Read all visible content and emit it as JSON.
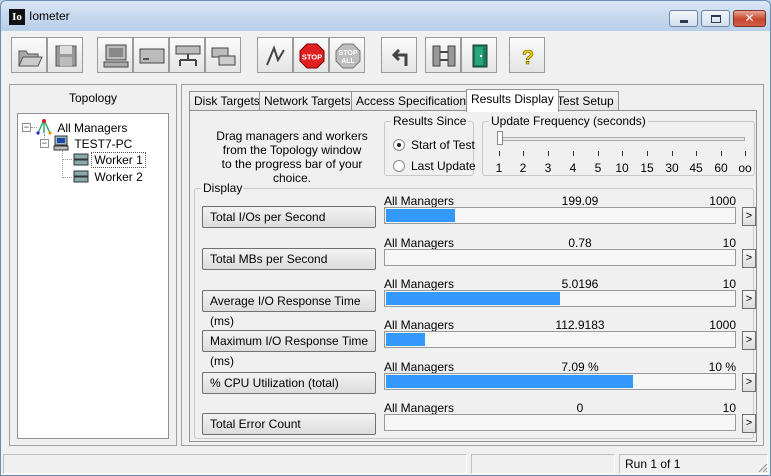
{
  "window": {
    "title": "Iometer",
    "app_icon": "Io"
  },
  "toolbar": {
    "buttons": [
      {
        "name": "open-icon"
      },
      {
        "name": "save-icon"
      },
      {
        "name": "new-manager-icon"
      },
      {
        "name": "new-disk-worker-icon"
      },
      {
        "name": "new-network-worker-icon"
      },
      {
        "name": "duplicate-worker-icon"
      },
      {
        "name": "start-tests-icon"
      },
      {
        "name": "stop-icon"
      },
      {
        "name": "stop-all-icon"
      },
      {
        "name": "reset-workers-icon"
      },
      {
        "name": "disconnect-icon"
      },
      {
        "name": "exit-icon"
      },
      {
        "name": "help-icon"
      }
    ],
    "stop_label": "STOP",
    "stop_all_label_1": "STOP",
    "stop_all_label_2": "ALL",
    "help_label": "?"
  },
  "topology": {
    "header": "Topology",
    "root": "All Managers",
    "manager": "TEST7-PC",
    "workers": [
      "Worker 1",
      "Worker 2"
    ]
  },
  "tabs": [
    "Disk Targets",
    "Network Targets",
    "Access Specifications",
    "Results Display",
    "Test Setup"
  ],
  "instructions": [
    "Drag managers and workers",
    "from the Topology window",
    "to the progress bar of your choice."
  ],
  "results_since": {
    "legend": "Results Since",
    "options": [
      "Start of Test",
      "Last Update"
    ],
    "selected": "Start of Test"
  },
  "update_frequency": {
    "legend": "Update Frequency (seconds)",
    "ticks": [
      "1",
      "2",
      "3",
      "4",
      "5",
      "10",
      "15",
      "30",
      "45",
      "60",
      "oo"
    ],
    "value": "1"
  },
  "display": {
    "legend": "Display",
    "rows": [
      {
        "button": "Total I/Os per Second",
        "source": "All Managers",
        "value": "199.09",
        "max": "1000",
        "fill": 0.199
      },
      {
        "button": "Total MBs per Second",
        "source": "All Managers",
        "value": "0.78",
        "max": "10",
        "fill": 0.0
      },
      {
        "button": "Average I/O Response Time (ms)",
        "source": "All Managers",
        "value": "5.0196",
        "max": "10",
        "fill": 0.5
      },
      {
        "button": "Maximum I/O Response Time (ms)",
        "source": "All Managers",
        "value": "112.9183",
        "max": "1000",
        "fill": 0.113
      },
      {
        "button": "% CPU Utilization (total)",
        "source": "All Managers",
        "value": "7.09 %",
        "max": "10 %",
        "fill": 0.709
      },
      {
        "button": "Total Error Count",
        "source": "All Managers",
        "value": "0",
        "max": "10",
        "fill": 0.0
      }
    ],
    "more_label": ">"
  },
  "status": {
    "run": "Run 1 of 1"
  },
  "colors": {
    "bar_fill": "#3399ff"
  }
}
